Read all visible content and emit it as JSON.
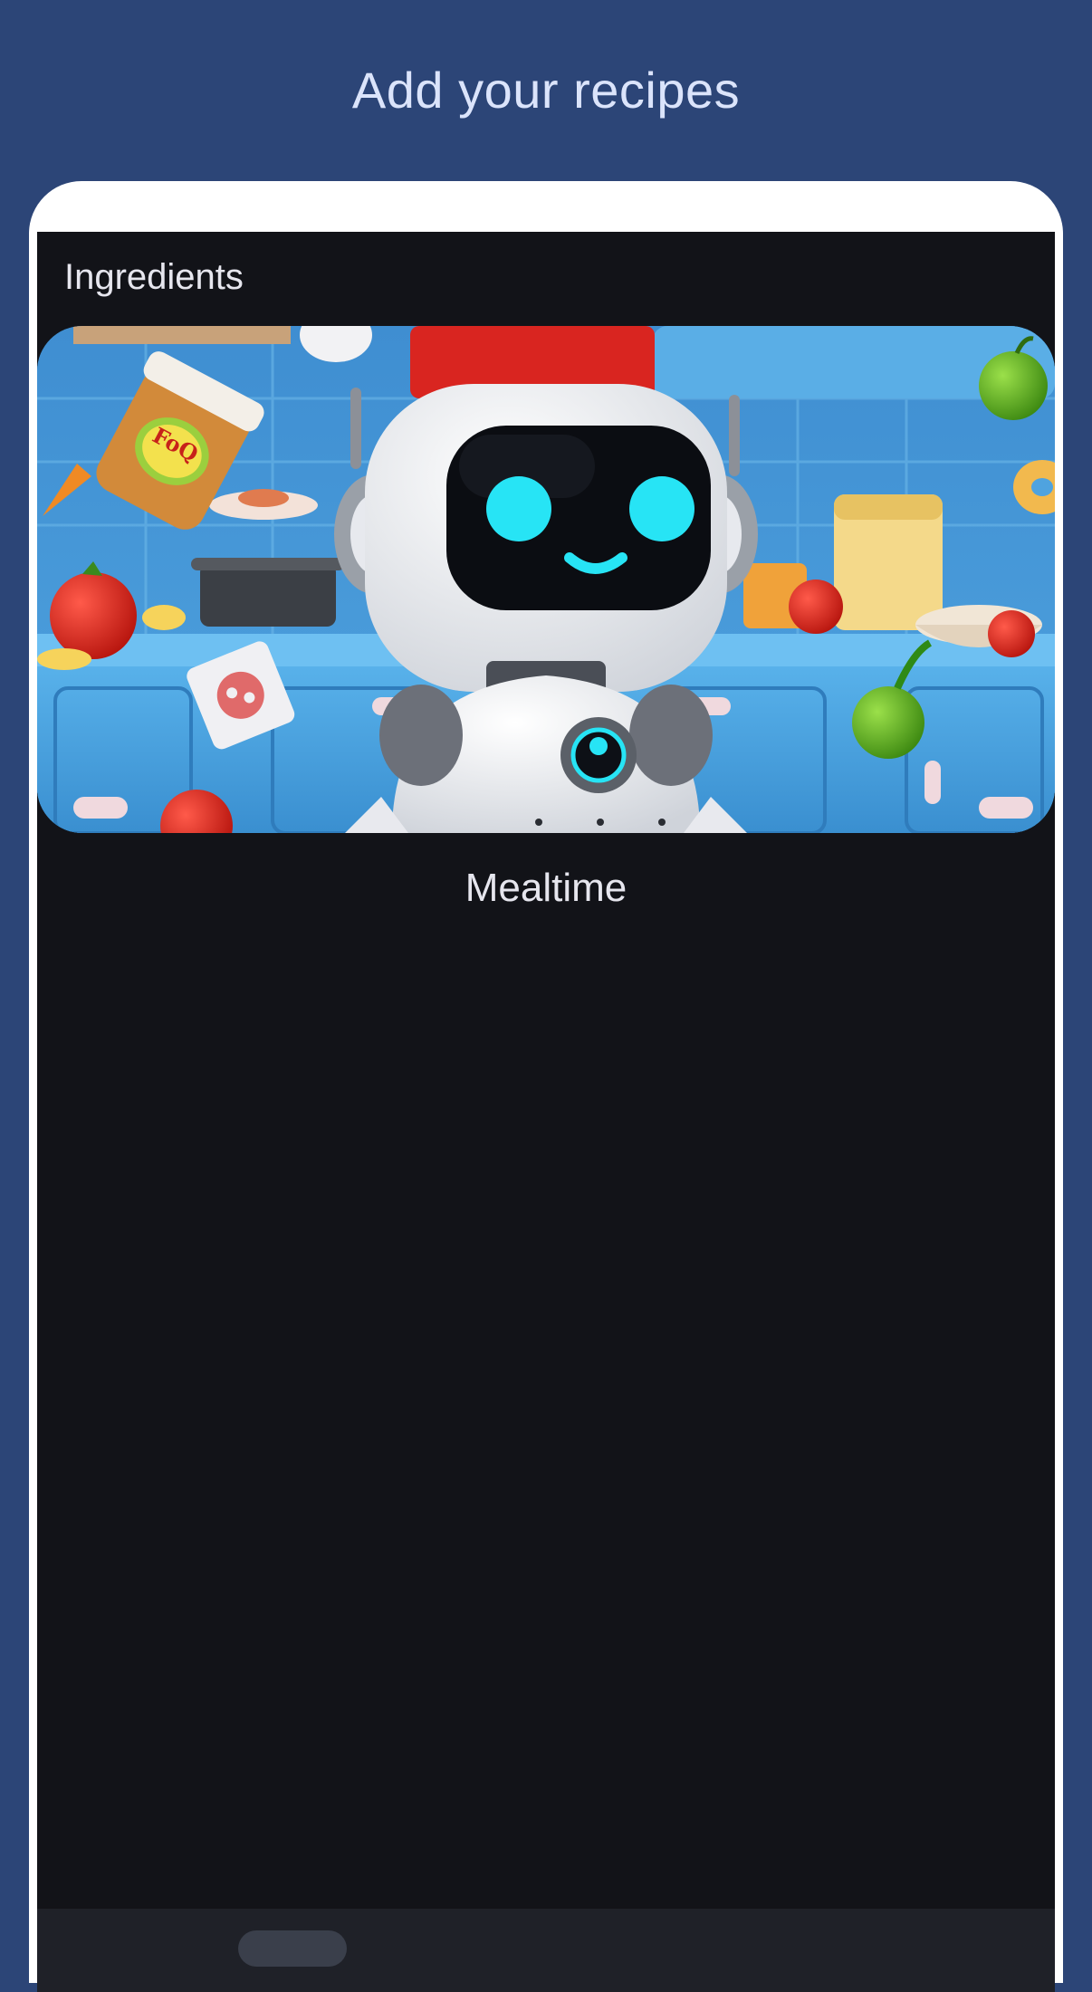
{
  "header": {
    "title": "Add your recipes"
  },
  "content": {
    "section_title": "Ingredients",
    "card": {
      "caption": "Mealtime",
      "image_label": "FoQ"
    }
  },
  "colors": {
    "background": "#2c4577",
    "title": "#dbe4fb",
    "screen": "#121318",
    "frame": "#ffffff",
    "robot_eyes": "#27e4f5",
    "chef_hat": "#d92520"
  },
  "icons": {
    "hero_image": "robot-chef-illustration"
  }
}
